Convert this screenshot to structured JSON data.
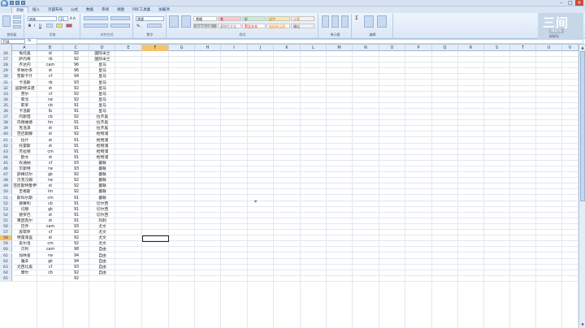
{
  "window": {
    "title": "",
    "tabs": [
      "开始",
      "插入",
      "页面布局",
      "公式",
      "数据",
      "审阅",
      "视图",
      "PDF工具集",
      "加载项"
    ],
    "active_tab": 0
  },
  "ribbon": {
    "font_name": "宋体",
    "font_size": "11",
    "number_format": "常规",
    "styles": [
      {
        "label": "常规",
        "bg": "#ffffff",
        "fg": "#000000"
      },
      {
        "label": "差",
        "bg": "#ffc7ce",
        "fg": "#9c0006"
      },
      {
        "label": "好",
        "bg": "#c6efce",
        "fg": "#006100"
      },
      {
        "label": "适中",
        "bg": "#ffeb9c",
        "fg": "#9c6500"
      },
      {
        "label": "计算",
        "bg": "#f2f2f2",
        "fg": "#fa7d00"
      },
      {
        "label": "检查单元格",
        "bg": "#a5a5a5",
        "fg": "#ffffff"
      },
      {
        "label": "解释性文本",
        "bg": "#ffffff",
        "fg": "#7f7f7f"
      },
      {
        "label": "警告文本",
        "bg": "#ffffff",
        "fg": "#ff0000"
      },
      {
        "label": "链接单元格",
        "bg": "#ffffff",
        "fg": "#fa7d00"
      },
      {
        "label": "输出",
        "bg": "#f2f2f2",
        "fg": "#3f3f3f"
      }
    ],
    "group_labels": [
      "剪贴板",
      "字体",
      "对齐方式",
      "数字",
      "样式",
      "单元格",
      "编辑"
    ]
  },
  "formula_bar": {
    "name_box": "F58",
    "fx": "fx",
    "value": ""
  },
  "watermark": {
    "line1": "三间",
    "line2": "微软号",
    "line3": "好好乐"
  },
  "columns": [
    "A",
    "B",
    "C",
    "D",
    "E",
    "F",
    "G",
    "H",
    "I",
    "J",
    "K",
    "L",
    "M",
    "N",
    "O",
    "P",
    "Q",
    "R",
    "S",
    "T",
    "U",
    "V"
  ],
  "selected_column": "F",
  "selected_row": 58,
  "rows": [
    {
      "n": 26,
      "a": "埃托奥",
      "b": "st",
      "c": "92",
      "d": "国际米兰"
    },
    {
      "n": 27,
      "a": "萨内蒂",
      "b": "rb",
      "c": "92",
      "d": "国际米兰"
    },
    {
      "n": 28,
      "a": "齐达内",
      "b": "cam",
      "c": "96",
      "d": "皇马"
    },
    {
      "n": 29,
      "a": "罗纳尔多",
      "b": "st",
      "c": "96",
      "d": "皇马"
    },
    {
      "n": 30,
      "a": "普斯卡什",
      "b": "cf",
      "c": "94",
      "d": "皇马"
    },
    {
      "n": 31,
      "a": "卡洛斯",
      "b": "rb",
      "c": "93",
      "d": "皇马"
    },
    {
      "n": 32,
      "a": "迪斯特法诺",
      "b": "st",
      "c": "92",
      "d": "皇马"
    },
    {
      "n": 33,
      "a": "劳尔",
      "b": "cf",
      "c": "92",
      "d": "皇马"
    },
    {
      "n": 34,
      "a": "菲戈",
      "b": "rw",
      "c": "92",
      "d": "皇马"
    },
    {
      "n": 35,
      "a": "耶罗",
      "b": "cb",
      "c": "91",
      "d": "皇马"
    },
    {
      "n": 36,
      "a": "卡洛斯",
      "b": "lb",
      "c": "91",
      "d": "皇马"
    },
    {
      "n": 37,
      "a": "内斯塔",
      "b": "cb",
      "c": "92",
      "d": "拉齐奥"
    },
    {
      "n": 38,
      "a": "内德维德",
      "b": "lm",
      "c": "91",
      "d": "拉齐奥"
    },
    {
      "n": 39,
      "a": "克洛泽",
      "b": "st",
      "c": "91",
      "d": "拉齐奥"
    },
    {
      "n": 40,
      "a": "范巴斯滕",
      "b": "st",
      "c": "92",
      "d": "枪物浦"
    },
    {
      "n": 41,
      "a": "拉什",
      "b": "st",
      "c": "91",
      "d": "枪物浦"
    },
    {
      "n": 42,
      "a": "托雷斯",
      "b": "st",
      "c": "91",
      "d": "枪物浦"
    },
    {
      "n": 43,
      "a": "杰拉德",
      "b": "cm",
      "c": "91",
      "d": "枪物浦"
    },
    {
      "n": 44,
      "a": "欧文",
      "b": "st",
      "c": "91",
      "d": "枪物浦"
    },
    {
      "n": 45,
      "a": "坎通纳",
      "b": "cf",
      "c": "93",
      "d": "曼联"
    },
    {
      "n": 46,
      "a": "贝斯特",
      "b": "rw",
      "c": "93",
      "d": "曼联"
    },
    {
      "n": 47,
      "a": "舒梅切尔",
      "b": "gk",
      "c": "92",
      "d": "曼联"
    },
    {
      "n": 48,
      "a": "贝克汉姆",
      "b": "rw",
      "c": "92",
      "d": "曼联"
    },
    {
      "n": 49,
      "a": "范尼斯特鲁伊",
      "b": "st",
      "c": "92",
      "d": "曼联"
    },
    {
      "n": 50,
      "a": "吉格斯",
      "b": "lm",
      "c": "92",
      "d": "曼联"
    },
    {
      "n": 51,
      "a": "斯科尔斯",
      "b": "cm",
      "c": "91",
      "d": "曼联"
    },
    {
      "n": 52,
      "a": "德赛利",
      "b": "cb",
      "c": "91",
      "d": "切尔西"
    },
    {
      "n": 53,
      "a": "切赫",
      "b": "gk",
      "c": "91",
      "d": "切尔西"
    },
    {
      "n": 54,
      "a": "德罗巴",
      "b": "st",
      "c": "91",
      "d": "切尔西"
    },
    {
      "n": 55,
      "a": "莱因克尔",
      "b": "st",
      "c": "91",
      "d": "热刺"
    },
    {
      "n": 56,
      "a": "巴乔",
      "b": "cam",
      "c": "93",
      "d": "尤文"
    },
    {
      "n": 57,
      "a": "皮耶罗",
      "b": "cf",
      "c": "92",
      "d": "尤文"
    },
    {
      "n": 58,
      "a": "特雷泽盖",
      "b": "st",
      "c": "92",
      "d": "尤文"
    },
    {
      "n": 59,
      "a": "皮尔洛",
      "b": "cm",
      "c": "92",
      "d": "尤文"
    },
    {
      "n": 60,
      "a": "贝利",
      "b": "cam",
      "c": "98",
      "d": "自由"
    },
    {
      "n": 61,
      "a": "加林查",
      "b": "rw",
      "c": "94",
      "d": "自由"
    },
    {
      "n": 62,
      "a": "雅辛",
      "b": "gk",
      "c": "94",
      "d": "自由"
    },
    {
      "n": 63,
      "a": "尤西比奥",
      "b": "cf",
      "c": "93",
      "d": "自由"
    },
    {
      "n": 64,
      "a": "摩尔",
      "b": "cb",
      "c": "92",
      "d": "自由"
    },
    {
      "n": 65,
      "a": "",
      "b": "",
      "c": "92",
      "d": ""
    }
  ]
}
